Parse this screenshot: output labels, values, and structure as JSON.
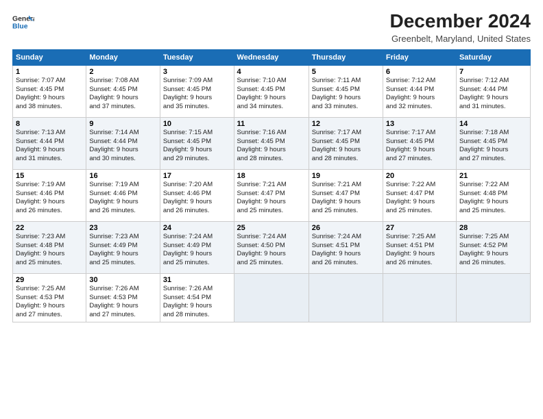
{
  "header": {
    "logo_line1": "General",
    "logo_line2": "Blue",
    "title": "December 2024",
    "location": "Greenbelt, Maryland, United States"
  },
  "columns": [
    "Sunday",
    "Monday",
    "Tuesday",
    "Wednesday",
    "Thursday",
    "Friday",
    "Saturday"
  ],
  "weeks": [
    [
      {
        "day": "1",
        "info": "Sunrise: 7:07 AM\nSunset: 4:45 PM\nDaylight: 9 hours\nand 38 minutes."
      },
      {
        "day": "2",
        "info": "Sunrise: 7:08 AM\nSunset: 4:45 PM\nDaylight: 9 hours\nand 37 minutes."
      },
      {
        "day": "3",
        "info": "Sunrise: 7:09 AM\nSunset: 4:45 PM\nDaylight: 9 hours\nand 35 minutes."
      },
      {
        "day": "4",
        "info": "Sunrise: 7:10 AM\nSunset: 4:45 PM\nDaylight: 9 hours\nand 34 minutes."
      },
      {
        "day": "5",
        "info": "Sunrise: 7:11 AM\nSunset: 4:45 PM\nDaylight: 9 hours\nand 33 minutes."
      },
      {
        "day": "6",
        "info": "Sunrise: 7:12 AM\nSunset: 4:44 PM\nDaylight: 9 hours\nand 32 minutes."
      },
      {
        "day": "7",
        "info": "Sunrise: 7:12 AM\nSunset: 4:44 PM\nDaylight: 9 hours\nand 31 minutes."
      }
    ],
    [
      {
        "day": "8",
        "info": "Sunrise: 7:13 AM\nSunset: 4:44 PM\nDaylight: 9 hours\nand 31 minutes."
      },
      {
        "day": "9",
        "info": "Sunrise: 7:14 AM\nSunset: 4:44 PM\nDaylight: 9 hours\nand 30 minutes."
      },
      {
        "day": "10",
        "info": "Sunrise: 7:15 AM\nSunset: 4:45 PM\nDaylight: 9 hours\nand 29 minutes."
      },
      {
        "day": "11",
        "info": "Sunrise: 7:16 AM\nSunset: 4:45 PM\nDaylight: 9 hours\nand 28 minutes."
      },
      {
        "day": "12",
        "info": "Sunrise: 7:17 AM\nSunset: 4:45 PM\nDaylight: 9 hours\nand 28 minutes."
      },
      {
        "day": "13",
        "info": "Sunrise: 7:17 AM\nSunset: 4:45 PM\nDaylight: 9 hours\nand 27 minutes."
      },
      {
        "day": "14",
        "info": "Sunrise: 7:18 AM\nSunset: 4:45 PM\nDaylight: 9 hours\nand 27 minutes."
      }
    ],
    [
      {
        "day": "15",
        "info": "Sunrise: 7:19 AM\nSunset: 4:46 PM\nDaylight: 9 hours\nand 26 minutes."
      },
      {
        "day": "16",
        "info": "Sunrise: 7:19 AM\nSunset: 4:46 PM\nDaylight: 9 hours\nand 26 minutes."
      },
      {
        "day": "17",
        "info": "Sunrise: 7:20 AM\nSunset: 4:46 PM\nDaylight: 9 hours\nand 26 minutes."
      },
      {
        "day": "18",
        "info": "Sunrise: 7:21 AM\nSunset: 4:47 PM\nDaylight: 9 hours\nand 25 minutes."
      },
      {
        "day": "19",
        "info": "Sunrise: 7:21 AM\nSunset: 4:47 PM\nDaylight: 9 hours\nand 25 minutes."
      },
      {
        "day": "20",
        "info": "Sunrise: 7:22 AM\nSunset: 4:47 PM\nDaylight: 9 hours\nand 25 minutes."
      },
      {
        "day": "21",
        "info": "Sunrise: 7:22 AM\nSunset: 4:48 PM\nDaylight: 9 hours\nand 25 minutes."
      }
    ],
    [
      {
        "day": "22",
        "info": "Sunrise: 7:23 AM\nSunset: 4:48 PM\nDaylight: 9 hours\nand 25 minutes."
      },
      {
        "day": "23",
        "info": "Sunrise: 7:23 AM\nSunset: 4:49 PM\nDaylight: 9 hours\nand 25 minutes."
      },
      {
        "day": "24",
        "info": "Sunrise: 7:24 AM\nSunset: 4:49 PM\nDaylight: 9 hours\nand 25 minutes."
      },
      {
        "day": "25",
        "info": "Sunrise: 7:24 AM\nSunset: 4:50 PM\nDaylight: 9 hours\nand 25 minutes."
      },
      {
        "day": "26",
        "info": "Sunrise: 7:24 AM\nSunset: 4:51 PM\nDaylight: 9 hours\nand 26 minutes."
      },
      {
        "day": "27",
        "info": "Sunrise: 7:25 AM\nSunset: 4:51 PM\nDaylight: 9 hours\nand 26 minutes."
      },
      {
        "day": "28",
        "info": "Sunrise: 7:25 AM\nSunset: 4:52 PM\nDaylight: 9 hours\nand 26 minutes."
      }
    ],
    [
      {
        "day": "29",
        "info": "Sunrise: 7:25 AM\nSunset: 4:53 PM\nDaylight: 9 hours\nand 27 minutes."
      },
      {
        "day": "30",
        "info": "Sunrise: 7:26 AM\nSunset: 4:53 PM\nDaylight: 9 hours\nand 27 minutes."
      },
      {
        "day": "31",
        "info": "Sunrise: 7:26 AM\nSunset: 4:54 PM\nDaylight: 9 hours\nand 28 minutes."
      },
      null,
      null,
      null,
      null
    ]
  ]
}
